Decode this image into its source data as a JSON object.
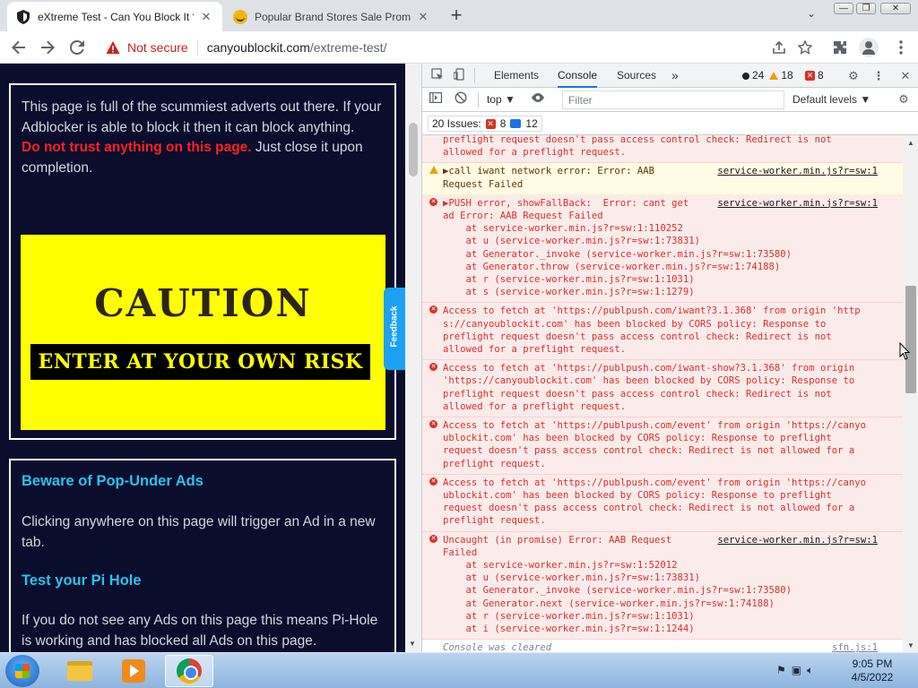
{
  "browser": {
    "tabs": [
      {
        "title": "eXtreme Test - Can You Block It ?",
        "close": "✕",
        "active": true
      },
      {
        "title": "Popular Brand Stores Sale Promo",
        "close": "✕",
        "active": false
      }
    ],
    "new_tab": "+",
    "tab_search": "⌄",
    "window_controls": {
      "minimize": "—",
      "maximize": "❐",
      "close": "✕"
    },
    "security_label": "Not secure",
    "url_host": "canyoublockit.com",
    "url_path": "/extreme-test/"
  },
  "page": {
    "intro_text": "This page is full of the scummiest adverts out there. If your Adblocker is able to block it then it can block anything.",
    "danger_text": "Do not trust anything on this page.",
    "after_danger": " Just close it upon completion.",
    "caution_title": "CAUTION",
    "caution_band": "ENTER AT YOUR OWN RISK",
    "feedback_label": "Feedback",
    "beware_heading": "Beware of Pop-Under Ads",
    "beware_text": "Clicking anywhere on this page will trigger an Ad in a new tab.",
    "pihole_heading": "Test your Pi Hole",
    "pihole_text": "If you do not see any Ads on this page this means Pi-Hole is working and has blocked all Ads on this page."
  },
  "devtools": {
    "tabs": {
      "elements": "Elements",
      "console": "Console",
      "sources": "Sources",
      "more": "»"
    },
    "counts": {
      "errors": "24",
      "warnings": "18",
      "issues": "8"
    },
    "context": "top ▼",
    "filter_placeholder": "Filter",
    "levels": "Default levels ▼",
    "issues_label": "20 Issues:",
    "issues_errors": "8",
    "issues_messages": "12",
    "console_cleared": "Console was cleared",
    "cleared_src": "sfn.js:1",
    "entries": [
      {
        "kind": "error",
        "lines": [
          "preflight request doesn't pass access control check: Redirect is not",
          "allowed for a preflight request."
        ],
        "src": ""
      },
      {
        "kind": "warn",
        "lines": [
          "▶call iwant network error: Error: AAB",
          "Request Failed"
        ],
        "src": "service-worker.min.js?r=sw:1"
      },
      {
        "kind": "error",
        "lines": [
          "▶PUSH error, showFallBack:  Error: cant get",
          "ad Error: AAB Request Failed",
          "    at service-worker.min.js?r=sw:1:110252",
          "    at u (service-worker.min.js?r=sw:1:73831)",
          "    at Generator._invoke (service-worker.min.js?r=sw:1:73580)",
          "    at Generator.throw (service-worker.min.js?r=sw:1:74188)",
          "    at r (service-worker.min.js?r=sw:1:1031)",
          "    at s (service-worker.min.js?r=sw:1:1279)"
        ],
        "src": "service-worker.min.js?r=sw:1"
      },
      {
        "kind": "error",
        "lines": [
          "Access to fetch at 'https://publpush.com/iwant?3.1.368' from origin 'http",
          "s://canyoublockit.com' has been blocked by CORS policy: Response to",
          "preflight request doesn't pass access control check: Redirect is not",
          "allowed for a preflight request."
        ],
        "src": ""
      },
      {
        "kind": "error",
        "lines": [
          "Access to fetch at 'https://publpush.com/iwant-show?3.1.368' from origin",
          "'https://canyoublockit.com' has been blocked by CORS policy: Response to",
          "preflight request doesn't pass access control check: Redirect is not",
          "allowed for a preflight request."
        ],
        "src": ""
      },
      {
        "kind": "error",
        "lines": [
          "Access to fetch at 'https://publpush.com/event' from origin 'https://canyo",
          "ublockit.com' has been blocked by CORS policy: Response to preflight",
          "request doesn't pass access control check: Redirect is not allowed for a",
          "preflight request."
        ],
        "src": ""
      },
      {
        "kind": "error",
        "lines": [
          "Access to fetch at 'https://publpush.com/event' from origin 'https://canyo",
          "ublockit.com' has been blocked by CORS policy: Response to preflight",
          "request doesn't pass access control check: Redirect is not allowed for a",
          "preflight request."
        ],
        "src": ""
      },
      {
        "kind": "error",
        "lines": [
          "Uncaught (in promise) Error: AAB Request",
          "Failed",
          "    at service-worker.min.js?r=sw:1:52012",
          "    at u (service-worker.min.js?r=sw:1:73831)",
          "    at Generator._invoke (service-worker.min.js?r=sw:1:73580)",
          "    at Generator.next (service-worker.min.js?r=sw:1:74188)",
          "    at r (service-worker.min.js?r=sw:1:1031)",
          "    at i (service-worker.min.js?r=sw:1:1244)"
        ],
        "src": "service-worker.min.js?r=sw:1"
      }
    ]
  },
  "taskbar": {
    "time": "9:05 PM",
    "date": "4/5/2022"
  },
  "colors": {
    "page_bg": "#0a0d2c",
    "danger": "#ff2121",
    "heading_cyan": "#29c4ea",
    "caution_yellow": "#ffff00",
    "console_error": "#d93025"
  }
}
